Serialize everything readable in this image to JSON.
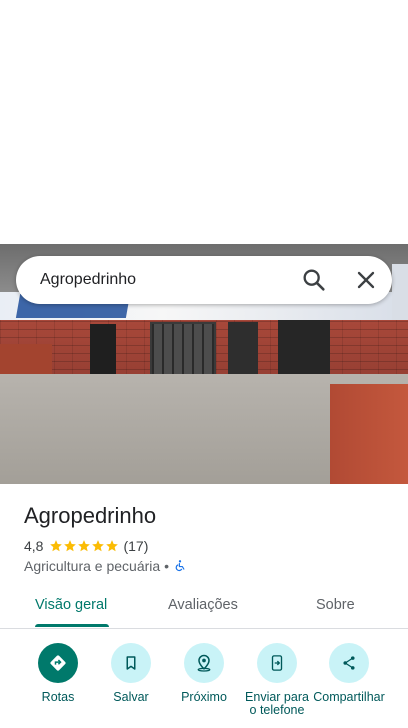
{
  "search": {
    "query": "Agropedrinho"
  },
  "place": {
    "name": "Agropedrinho",
    "rating": "4,8",
    "stars": 5,
    "review_count": "(17)",
    "category": "Agricultura e pecuária •"
  },
  "tabs": [
    {
      "label": "Visão geral",
      "active": true
    },
    {
      "label": "Avaliações",
      "active": false
    },
    {
      "label": "Sobre",
      "active": false
    }
  ],
  "actions": [
    {
      "label": "Rotas",
      "icon": "directions-icon"
    },
    {
      "label": "Salvar",
      "icon": "bookmark-icon"
    },
    {
      "label": "Próximo",
      "icon": "nearby-icon"
    },
    {
      "label": "Enviar para o telefone",
      "icon": "send-to-phone-icon"
    },
    {
      "label": "Compartilhar",
      "icon": "share-icon"
    }
  ],
  "colors": {
    "accent": "#00796b",
    "chip": "#c9f3f7",
    "star": "#fbbc04"
  }
}
